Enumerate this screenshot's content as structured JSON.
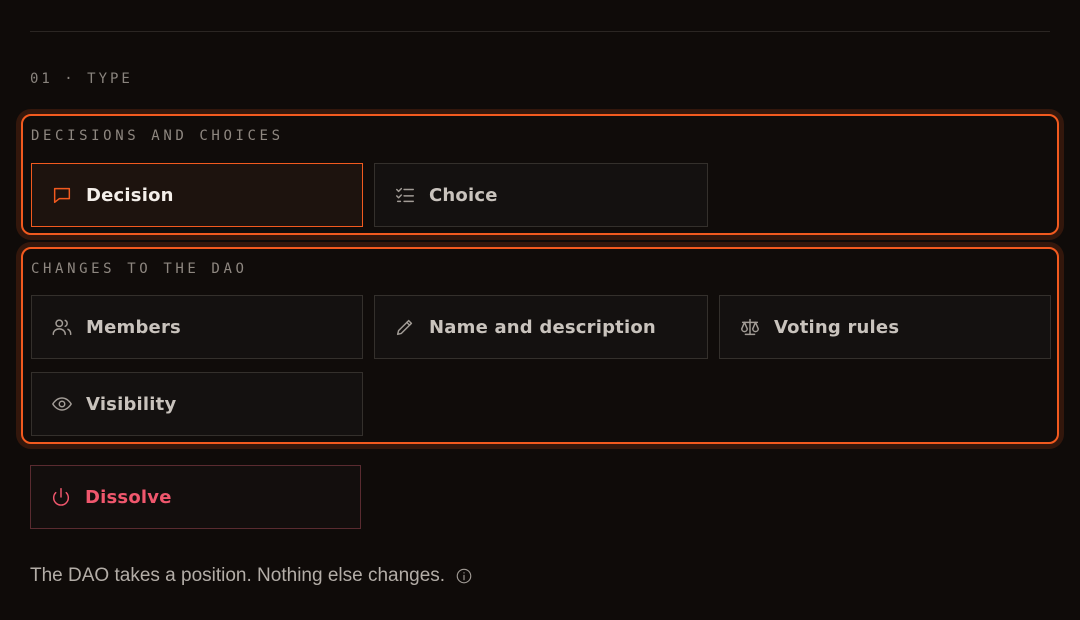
{
  "section": {
    "label": "01 · TYPE"
  },
  "groups": [
    {
      "label": "DECISIONS AND CHOICES",
      "options": [
        {
          "label": "Decision",
          "icon": "message-square-icon",
          "selected": true
        },
        {
          "label": "Choice",
          "icon": "list-checks-icon",
          "selected": false
        }
      ]
    },
    {
      "label": "CHANGES TO THE DAO",
      "options": [
        {
          "label": "Members",
          "icon": "users-icon",
          "selected": false
        },
        {
          "label": "Name and description",
          "icon": "pencil-icon",
          "selected": false
        },
        {
          "label": "Voting rules",
          "icon": "scale-icon",
          "selected": false
        },
        {
          "label": "Visibility",
          "icon": "eye-icon",
          "selected": false
        }
      ]
    }
  ],
  "dissolve": {
    "label": "Dissolve",
    "icon": "power-icon"
  },
  "helper": {
    "text": "The DAO takes a position. Nothing else changes.",
    "icon": "info-icon"
  },
  "colors": {
    "accent": "#f25a1f",
    "danger": "#f0576d",
    "background": "#0f0b09"
  }
}
